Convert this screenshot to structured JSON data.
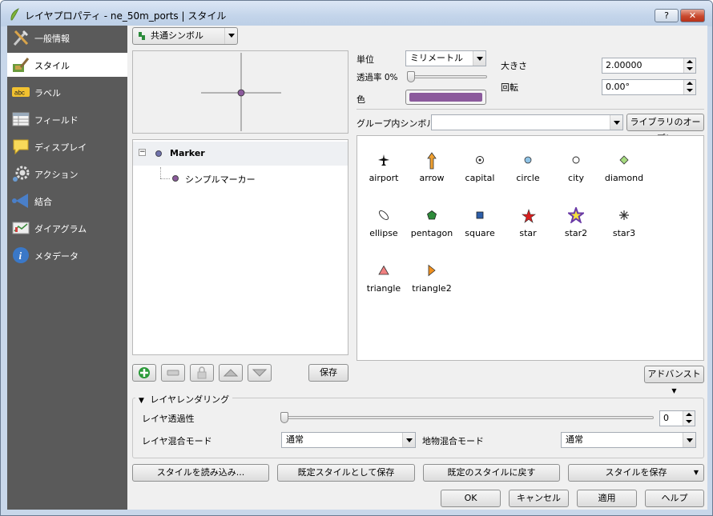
{
  "window": {
    "title": "レイヤプロパティ - ne_50m_ports | スタイル",
    "help_btn": "?",
    "close_btn": "✕"
  },
  "sidebar": {
    "items": [
      {
        "label": "一般情報",
        "icon": "tools-icon"
      },
      {
        "label": "スタイル",
        "icon": "style-brush-icon"
      },
      {
        "label": "ラベル",
        "icon": "abc-label-icon"
      },
      {
        "label": "フィールド",
        "icon": "table-fields-icon"
      },
      {
        "label": "ディスプレイ",
        "icon": "speech-bubble-icon"
      },
      {
        "label": "アクション",
        "icon": "gear-action-icon"
      },
      {
        "label": "結合",
        "icon": "join-arrow-icon"
      },
      {
        "label": "ダイアグラム",
        "icon": "diagram-icon"
      },
      {
        "label": "メタデータ",
        "icon": "info-icon"
      }
    ],
    "selected_index": 1
  },
  "renderer": {
    "value": "共通シンボル"
  },
  "tree": {
    "root": "Marker",
    "child": "シンプルマーカー"
  },
  "props": {
    "unit_label": "単位",
    "unit_value": "ミリメートル",
    "transparency_label": "透過率 0%",
    "color_label": "色",
    "color_value": "#8b5a9c",
    "size_label": "大きさ",
    "size_value": "2.00000",
    "rotation_label": "回転",
    "rotation_value": "0.00°"
  },
  "group": {
    "label": "グループ内シンボル",
    "value": "",
    "library_button": "ライブラリのオープン"
  },
  "symbols": [
    {
      "name": "airport",
      "icon": "airplane-icon"
    },
    {
      "name": "arrow",
      "icon": "arrow-up-icon"
    },
    {
      "name": "capital",
      "icon": "capital-icon"
    },
    {
      "name": "circle",
      "icon": "circle-icon"
    },
    {
      "name": "city",
      "icon": "city-icon"
    },
    {
      "name": "diamond",
      "icon": "diamond-icon"
    },
    {
      "name": "ellipse",
      "icon": "ellipse-icon"
    },
    {
      "name": "pentagon",
      "icon": "pentagon-icon"
    },
    {
      "name": "square",
      "icon": "square-icon"
    },
    {
      "name": "star",
      "icon": "star-icon"
    },
    {
      "name": "star2",
      "icon": "star2-icon"
    },
    {
      "name": "star3",
      "icon": "star3-icon"
    },
    {
      "name": "triangle",
      "icon": "triangle-icon"
    },
    {
      "name": "triangle2",
      "icon": "triangle2-icon"
    }
  ],
  "layer_buttons": {
    "save": "保存",
    "advanced": "アドバンスト"
  },
  "rendering": {
    "title": "レイヤレンダリング",
    "transparency_label": "レイヤ透過性",
    "transparency_value": "0",
    "blend_label": "レイヤ混合モード",
    "blend_value": "通常",
    "feature_blend_label": "地物混合モード",
    "feature_blend_value": "通常"
  },
  "style_buttons": {
    "load": "スタイルを読み込み...",
    "save_default": "既定スタイルとして保存",
    "restore_default": "既定のスタイルに戻す",
    "save_style": "スタイルを保存"
  },
  "dialog_buttons": {
    "ok": "OK",
    "cancel": "キャンセル",
    "apply": "適用",
    "help": "ヘルプ"
  }
}
